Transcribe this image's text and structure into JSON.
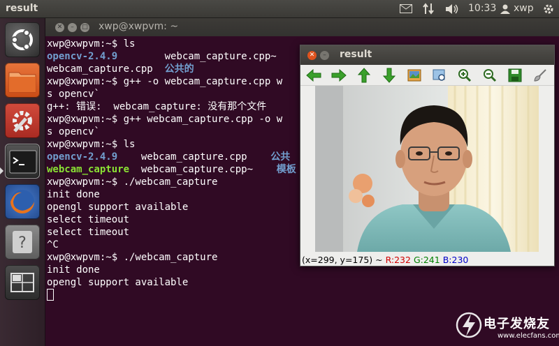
{
  "top_panel": {
    "app_title": "result",
    "clock": "10:33",
    "user": "xwp",
    "indicators": [
      "mail-icon",
      "network-arrows-icon",
      "volume-icon",
      "power-gear-icon"
    ]
  },
  "launcher": {
    "items": [
      {
        "name": "ubuntu-dash-icon"
      },
      {
        "name": "files-folder-icon"
      },
      {
        "name": "system-settings-icon"
      },
      {
        "name": "terminal-icon",
        "active": true
      },
      {
        "name": "firefox-icon"
      },
      {
        "name": "help-icon"
      },
      {
        "name": "workspace-switcher-icon"
      }
    ]
  },
  "terminal": {
    "title": "xwp@xwpvm: ~",
    "lines": [
      {
        "segs": [
          {
            "t": "xwp@xwpvm:~$ ls"
          }
        ]
      },
      {
        "segs": [
          {
            "t": "opencv-2.4.9",
            "c": "c-blue"
          },
          {
            "t": "        webcam_capture.cpp~"
          }
        ]
      },
      {
        "segs": [
          {
            "t": "webcam_capture.cpp  "
          },
          {
            "t": "公共的",
            "c": "c-blue"
          }
        ]
      },
      {
        "segs": [
          {
            "t": "xwp@xwpvm:~$ g++ -o webcam_capture.cpp w"
          }
        ]
      },
      {
        "segs": [
          {
            "t": "s opencv`"
          }
        ]
      },
      {
        "segs": [
          {
            "t": "g++: 错误:  webcam_capture: 没有那个文件"
          }
        ]
      },
      {
        "segs": [
          {
            "t": "xwp@xwpvm:~$ g++ webcam_capture.cpp -o w"
          }
        ]
      },
      {
        "segs": [
          {
            "t": "s opencv`"
          }
        ]
      },
      {
        "segs": [
          {
            "t": "xwp@xwpvm:~$ ls"
          }
        ]
      },
      {
        "segs": [
          {
            "t": "opencv-2.4.9",
            "c": "c-blue"
          },
          {
            "t": "    webcam_capture.cpp    "
          },
          {
            "t": "公共",
            "c": "c-blue"
          }
        ]
      },
      {
        "segs": [
          {
            "t": "webcam_capture",
            "c": "c-green"
          },
          {
            "t": "  webcam_capture.cpp~    "
          },
          {
            "t": "模板",
            "c": "c-blue"
          }
        ]
      },
      {
        "segs": [
          {
            "t": "xwp@xwpvm:~$ ./webcam_capture"
          }
        ]
      },
      {
        "segs": [
          {
            "t": "init done"
          }
        ]
      },
      {
        "segs": [
          {
            "t": "opengl support available"
          }
        ]
      },
      {
        "segs": [
          {
            "t": "select timeout"
          }
        ]
      },
      {
        "segs": [
          {
            "t": "select timeout"
          }
        ]
      },
      {
        "segs": [
          {
            "t": "^C"
          }
        ]
      },
      {
        "segs": [
          {
            "t": "xwp@xwpvm:~$ ./webcam_capture"
          }
        ]
      },
      {
        "segs": [
          {
            "t": "init done"
          }
        ]
      },
      {
        "segs": [
          {
            "t": "opengl support available"
          }
        ]
      }
    ]
  },
  "result_window": {
    "title": "result",
    "toolbar": [
      "arrow-left-icon",
      "arrow-right-icon",
      "arrow-up-icon",
      "arrow-down-icon",
      "save-image-icon",
      "zoom-image-icon",
      "zoom-in-icon",
      "zoom-out-icon",
      "save-icon",
      "properties-brush-icon"
    ],
    "status": {
      "coords": "(x=299, y=175) ~ ",
      "r": "R:232",
      "g": "G:241",
      "b": "B:230"
    }
  },
  "watermark": {
    "title": "电子发烧友",
    "url": "www.elecfans.com"
  }
}
